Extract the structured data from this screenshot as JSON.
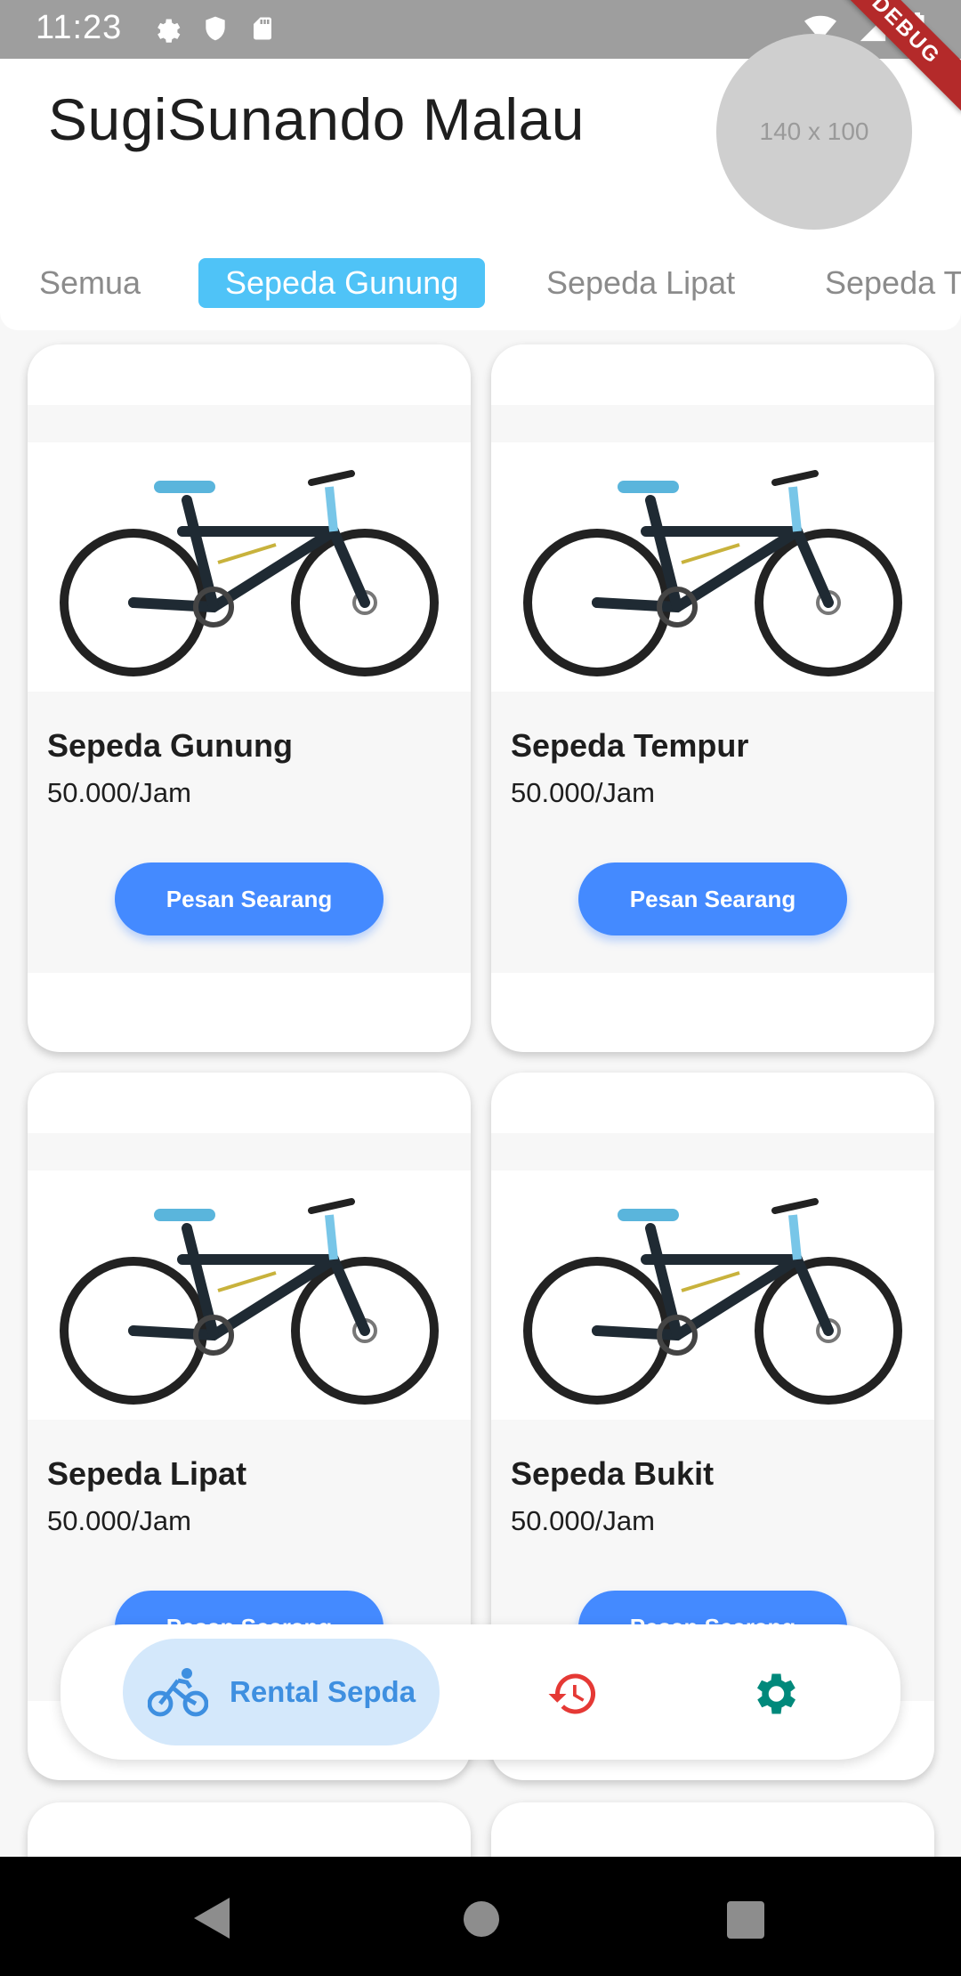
{
  "status_bar": {
    "time": "11:23",
    "left_icons": [
      "gear-icon",
      "shield-icon",
      "sd-card-icon"
    ],
    "right_icons": [
      "wifi-icon",
      "signal-icon",
      "battery-icon"
    ]
  },
  "debug_banner": "DEBUG",
  "header": {
    "user_name": "SugiSunando Malau",
    "avatar_placeholder": "140 x 100"
  },
  "tabs": [
    {
      "label": "Semua",
      "active": false
    },
    {
      "label": "Sepeda Gunung",
      "active": true
    },
    {
      "label": "Sepeda Lipat",
      "active": false
    },
    {
      "label": "Sepeda T",
      "active": false
    }
  ],
  "products": [
    {
      "name": "Sepeda Gunung",
      "price": "50.000/Jam",
      "button": "Pesan Searang"
    },
    {
      "name": "Sepeda Tempur",
      "price": "50.000/Jam",
      "button": "Pesan Searang"
    },
    {
      "name": "Sepeda Lipat",
      "price": "50.000/Jam",
      "button": "Pesan Searang"
    },
    {
      "name": "Sepeda Bukit",
      "price": "50.000/Jam",
      "button": "Pesan Searang"
    }
  ],
  "bottom_nav": {
    "active_label": "Rental Sepda",
    "items": [
      "bicycle-icon",
      "history-icon",
      "settings-icon"
    ]
  },
  "colors": {
    "accent_blue": "#448aff",
    "tab_active": "#4fc3f7",
    "history_red": "#e53935",
    "settings_teal": "#00897b",
    "debug_red": "#b42a2a"
  }
}
